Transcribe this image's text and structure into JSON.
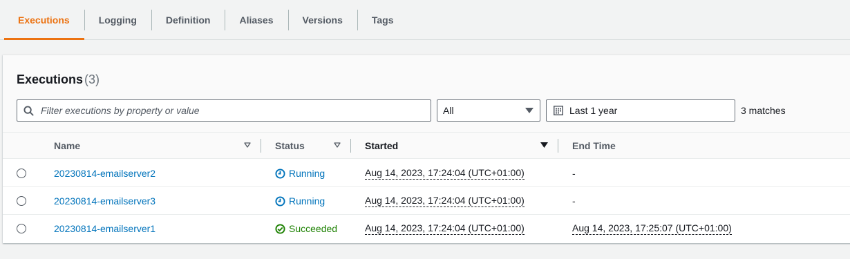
{
  "tabs": [
    {
      "label": "Executions",
      "active": true
    },
    {
      "label": "Logging",
      "active": false
    },
    {
      "label": "Definition",
      "active": false
    },
    {
      "label": "Aliases",
      "active": false
    },
    {
      "label": "Versions",
      "active": false
    },
    {
      "label": "Tags",
      "active": false
    }
  ],
  "panel": {
    "title": "Executions",
    "count": "(3)",
    "filter_placeholder": "Filter executions by property or value",
    "status_filter": "All",
    "date_range": "Last 1 year",
    "matches": "3 matches"
  },
  "table": {
    "columns": [
      "Name",
      "Status",
      "Started",
      "End Time"
    ],
    "rows": [
      {
        "name": "20230814-emailserver2",
        "status": "Running",
        "started": "Aug 14, 2023, 17:24:04 (UTC+01:00)",
        "end_time": "-"
      },
      {
        "name": "20230814-emailserver3",
        "status": "Running",
        "started": "Aug 14, 2023, 17:24:04 (UTC+01:00)",
        "end_time": "-"
      },
      {
        "name": "20230814-emailserver1",
        "status": "Succeeded",
        "started": "Aug 14, 2023, 17:24:04 (UTC+01:00)",
        "end_time": "Aug 14, 2023, 17:25:07 (UTC+01:00)"
      }
    ]
  },
  "colors": {
    "active_tab": "#ec7211",
    "link": "#0073bb",
    "running": "#0073bb",
    "succeeded": "#1d8102"
  },
  "icons": {
    "search": "search-icon",
    "dropdown": "caret-down-icon",
    "calendar": "calendar-icon",
    "running": "clock-icon",
    "succeeded": "check-circle-icon",
    "sort": "sort-caret-icon"
  }
}
